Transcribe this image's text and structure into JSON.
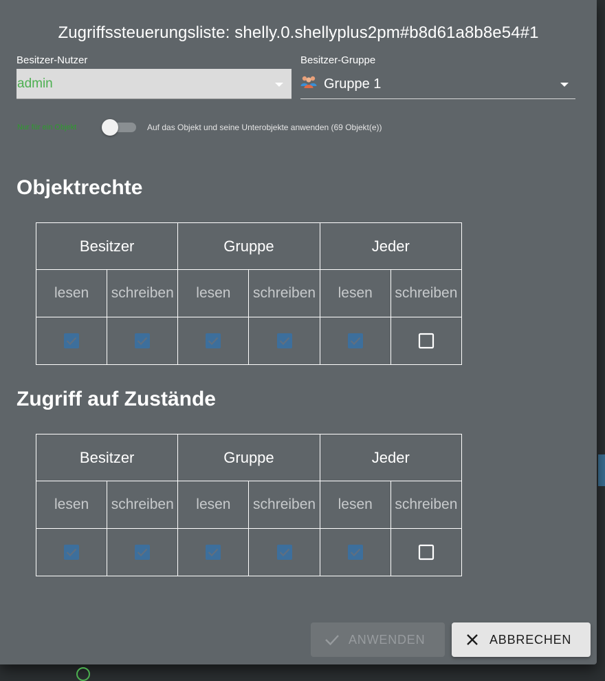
{
  "dialog": {
    "title": "Zugriffssteuerungsliste: shelly.0.shellyplus2pm#b8d61a8b8e54#1"
  },
  "owner_user": {
    "label": "Besitzer-Nutzer",
    "value": "admin"
  },
  "owner_group": {
    "label": "Besitzer-Gruppe",
    "value": "Gruppe 1",
    "icon": "users-group-icon"
  },
  "switch": {
    "left_label": "Nur für ein Objekt",
    "right_label": "Auf das Objekt und seine Unterobjekte anwenden (69 Objekt(e))",
    "checked": false
  },
  "object_rights": {
    "title": "Objektrechte",
    "headers": [
      "Besitzer",
      "Gruppe",
      "Jeder"
    ],
    "sub_headers": [
      "lesen",
      "schreiben",
      "lesen",
      "schreiben",
      "lesen",
      "schreiben"
    ],
    "checked": [
      true,
      true,
      true,
      true,
      true,
      false
    ]
  },
  "state_rights": {
    "title": "Zugriff auf Zustände",
    "headers": [
      "Besitzer",
      "Gruppe",
      "Jeder"
    ],
    "sub_headers": [
      "lesen",
      "schreiben",
      "lesen",
      "schreiben",
      "lesen",
      "schreiben"
    ],
    "checked": [
      true,
      true,
      true,
      true,
      true,
      false
    ]
  },
  "buttons": {
    "apply": "ANWENDEN",
    "cancel": "ABBRECHEN"
  },
  "colors": {
    "dialog_bg": "#5f6569",
    "accent_green": "#4caf50",
    "checkbox_disabled_blue": "#3d6f9c"
  }
}
